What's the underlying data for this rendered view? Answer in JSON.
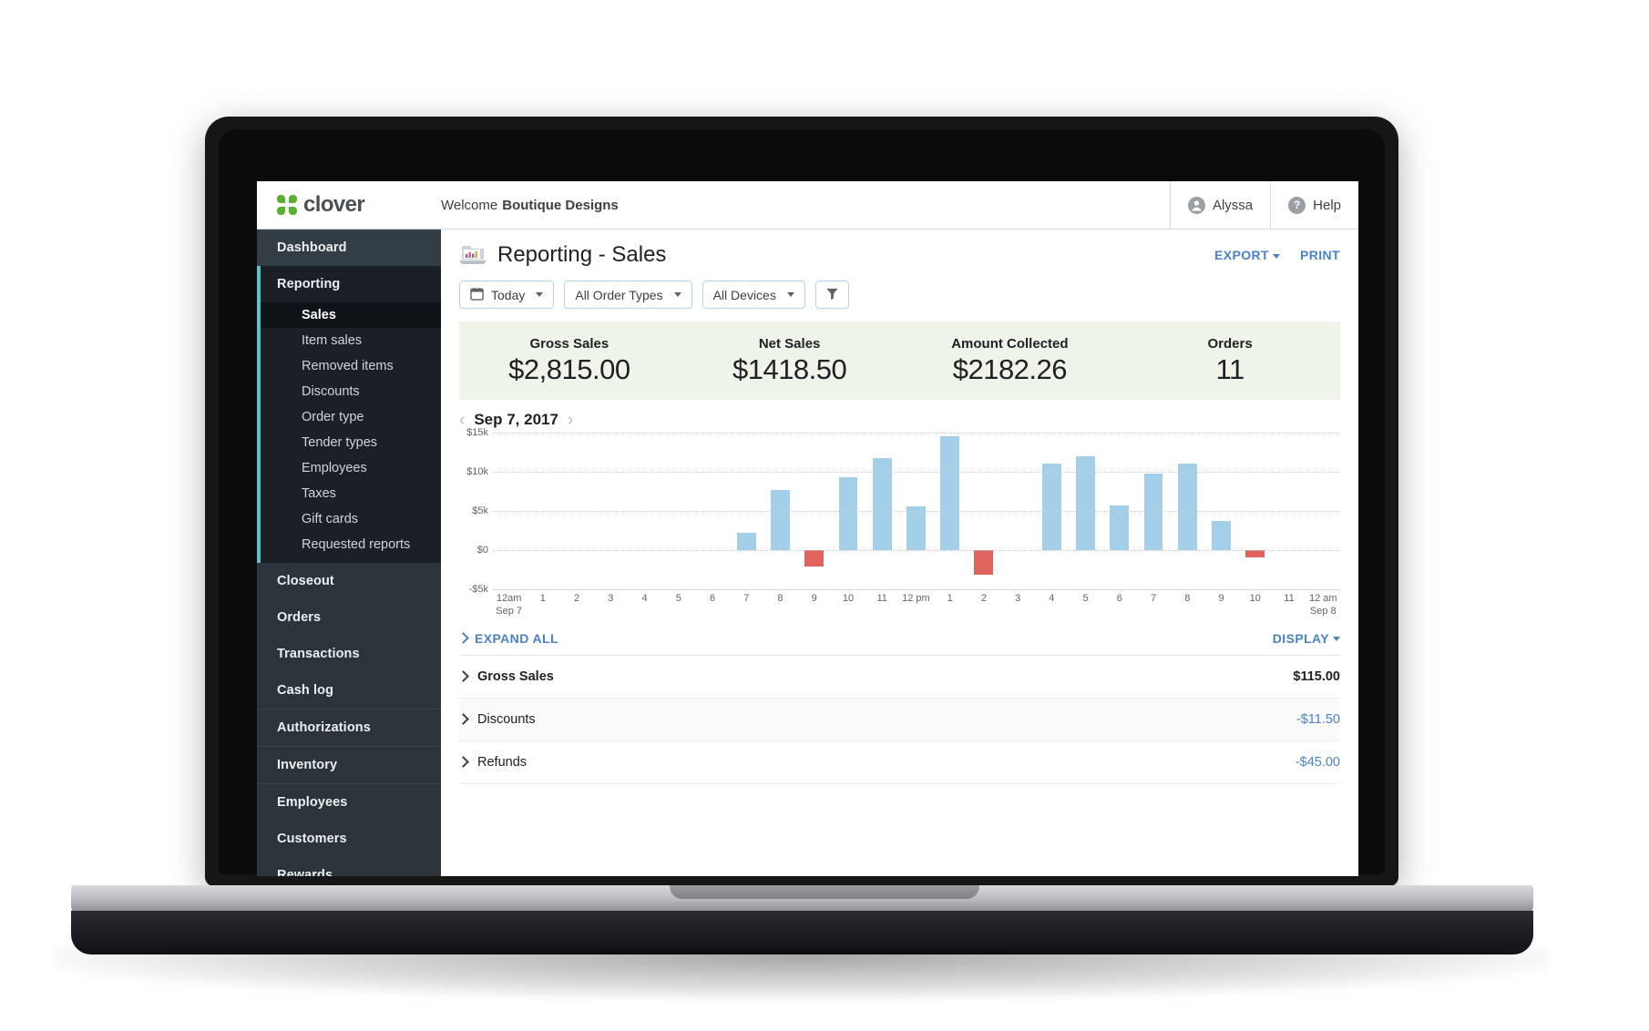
{
  "brand": {
    "name": "clover",
    "logo_icon": "clover-logo-icon"
  },
  "topbar": {
    "welcome_prefix": "Welcome",
    "merchant": "Boutique Designs",
    "user": {
      "label": "Alyssa",
      "icon": "account-circle-icon"
    },
    "help": {
      "label": "Help",
      "icon": "help-circle-icon"
    }
  },
  "sidebar": {
    "items": [
      {
        "label": "Dashboard"
      },
      {
        "label": "Reporting"
      },
      {
        "label": "Closeout"
      },
      {
        "label": "Orders"
      },
      {
        "label": "Transactions"
      },
      {
        "label": "Cash log"
      },
      {
        "label": "Authorizations"
      },
      {
        "label": "Inventory"
      },
      {
        "label": "Employees"
      },
      {
        "label": "Customers"
      },
      {
        "label": "Rewards"
      }
    ],
    "reporting_subitems": [
      {
        "label": "Sales",
        "active": true
      },
      {
        "label": "Item sales",
        "active": false
      },
      {
        "label": "Removed items",
        "active": false
      },
      {
        "label": "Discounts",
        "active": false
      },
      {
        "label": "Order type",
        "active": false
      },
      {
        "label": "Tender types",
        "active": false
      },
      {
        "label": "Employees",
        "active": false
      },
      {
        "label": "Taxes",
        "active": false
      },
      {
        "label": "Gift cards",
        "active": false
      },
      {
        "label": "Requested reports",
        "active": false
      }
    ],
    "accent_color": "#63c0c6",
    "background_color": "#2b343b"
  },
  "page": {
    "title": "Reporting - Sales",
    "title_icon": "report-chart-icon",
    "export_label": "EXPORT",
    "print_label": "PRINT"
  },
  "filters": {
    "date": {
      "label": "Today",
      "icon": "calendar-icon"
    },
    "order_types": {
      "label": "All Order Types"
    },
    "devices": {
      "label": "All Devices"
    },
    "filter_icon": "funnel-filter-icon"
  },
  "kpis": [
    {
      "label": "Gross Sales",
      "value": "$2,815.00"
    },
    {
      "label": "Net Sales",
      "value": "$1418.50"
    },
    {
      "label": "Amount Collected",
      "value": "$2182.26"
    },
    {
      "label": "Orders",
      "value": "11"
    }
  ],
  "date_nav": {
    "prev_icon": "chevron-left-icon",
    "label": "Sep 7, 2017",
    "next_icon": "chevron-right-icon"
  },
  "table": {
    "expand_all_label": "EXPAND ALL",
    "display_label": "DISPLAY",
    "rows": [
      {
        "label": "Gross Sales",
        "value": "$115.00",
        "value_style": "dark"
      },
      {
        "label": "Discounts",
        "value": "-$11.50",
        "value_style": "blue"
      },
      {
        "label": "Refunds",
        "value": "-$45.00",
        "value_style": "blue"
      }
    ]
  },
  "chart_data": {
    "type": "bar",
    "title": "Sep 7, 2017",
    "xlabel": "",
    "ylabel": "",
    "ylim": [
      -5000,
      15000
    ],
    "ytick_labels": [
      "$15k",
      "$10k",
      "$5k",
      "$0",
      "-$5k"
    ],
    "ytick_values": [
      15000,
      10000,
      5000,
      0,
      -5000
    ],
    "grid": true,
    "legend": "none",
    "positive_color": "#a4cfe8",
    "negative_color": "#e0625c",
    "categories": [
      "12am",
      "1",
      "2",
      "3",
      "4",
      "5",
      "6",
      "7",
      "8",
      "9",
      "10",
      "11",
      "12 pm",
      "1",
      "2",
      "3",
      "4",
      "5",
      "6",
      "7",
      "8",
      "9",
      "10",
      "11",
      "12 am"
    ],
    "x_start_date": "Sep 7",
    "x_end_date": "Sep 8",
    "values": [
      0,
      0,
      0,
      0,
      0,
      0,
      0,
      2200,
      7700,
      -2100,
      9300,
      11800,
      5600,
      14500,
      -3100,
      0,
      11000,
      12000,
      5700,
      9800,
      11100,
      3700,
      -900,
      0,
      0
    ]
  }
}
